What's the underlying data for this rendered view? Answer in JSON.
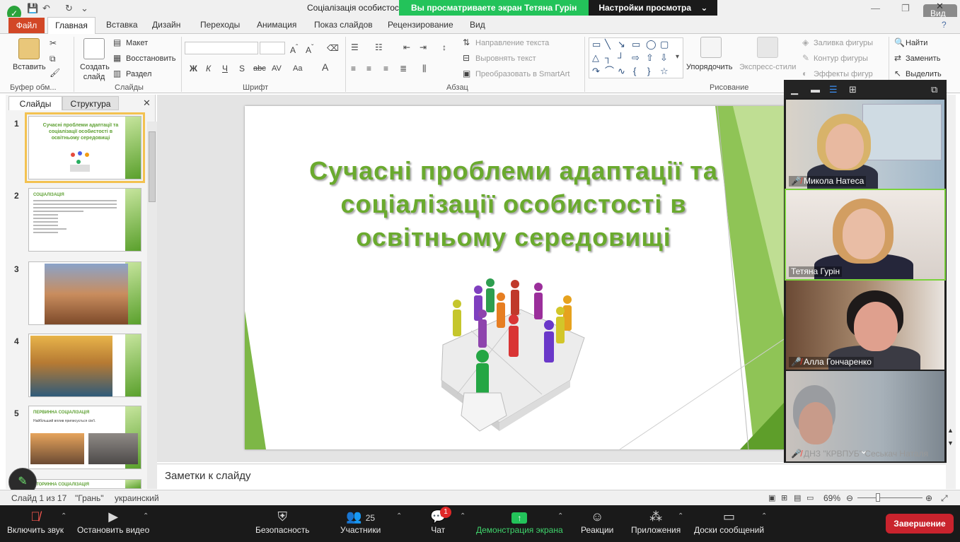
{
  "window": {
    "doc_title": "Соціалізація особистост",
    "view_button": "Вид"
  },
  "share_banner": {
    "viewing": "Вы просматриваете экран Тетяна Гурін",
    "settings": "Настройки просмотра"
  },
  "ribbon_tabs": [
    "Файл",
    "Главная",
    "Вставка",
    "Дизайн",
    "Переходы",
    "Анимация",
    "Показ слайдов",
    "Рецензирование",
    "Вид"
  ],
  "ribbon": {
    "clipboard": {
      "paste": "Вставить",
      "label": "Буфер обм..."
    },
    "slides": {
      "new_slide": "Создать слайд",
      "layout": "Макет",
      "reset": "Восстановить",
      "section": "Раздел",
      "label": "Слайды"
    },
    "font": {
      "label": "Шрифт",
      "bold": "Ж",
      "italic": "К",
      "underline": "Ч",
      "strike": "abc",
      "shadow": "S",
      "spacing": "AV",
      "case": "Aa"
    },
    "paragraph": {
      "text_direction": "Направление текста",
      "align_text": "Выровнять текст",
      "smartart": "Преобразовать в SmartArt",
      "label": "Абзац"
    },
    "drawing": {
      "arrange": "Упорядочить",
      "quick_styles": "Экспресс-стили",
      "fill": "Заливка фигуры",
      "outline": "Контур фигуры",
      "effects": "Эффекты фигур",
      "label": "Рисование"
    },
    "editing": {
      "find": "Найти",
      "replace": "Заменить",
      "select": "Выделить"
    }
  },
  "left_panel": {
    "tab_slides": "Слайды",
    "tab_outline": "Структура",
    "thumbnails": [
      {
        "num": "1",
        "title": "Сучасні проблеми адаптації та соціалізації особистості в освітньому середовищі"
      },
      {
        "num": "2",
        "title": "СОЦІАЛІЗАЦІЯ"
      },
      {
        "num": "3",
        "title": ""
      },
      {
        "num": "4",
        "title": ""
      },
      {
        "num": "5",
        "title": "ПЕРВИННА СОЦІАЛІЗАЦІЯ",
        "subtitle": "Найбільший вплив приписується сім'ї."
      },
      {
        "num": "6",
        "title": "ВТОРИННА СОЦІАЛІЗАЦІЯ"
      }
    ]
  },
  "slide": {
    "title": "Сучасні проблеми адаптації та соціалізації особистості в освітньому середовищі"
  },
  "notes": {
    "placeholder": "Заметки к слайду"
  },
  "status": {
    "slide_of": "Слайд 1 из 17",
    "theme": "\"Грань\"",
    "language": "украинский",
    "zoom": "69%"
  },
  "participants": [
    {
      "name": "Микола Натеса",
      "muted": true
    },
    {
      "name": "Тетяна Гурін",
      "muted": false
    },
    {
      "name": "Алла Гончаренко",
      "muted": true
    },
    {
      "name": "ДНЗ \"КРВПУБ\" Сеськач Наталя",
      "muted": true
    }
  ],
  "zoom_toolbar": {
    "unmute": "Включить звук",
    "stop_video": "Остановить видео",
    "security": "Безопасность",
    "participants": "Участники",
    "participants_count": "25",
    "chat": "Чат",
    "chat_badge": "1",
    "share_screen": "Демонстрация экрана",
    "reactions": "Реакции",
    "apps": "Приложения",
    "whiteboards": "Доски сообщений",
    "end": "Завершение"
  },
  "colors": {
    "slide_title_green": "#6aaa2e",
    "file_tab": "#d24726",
    "share_banner_green": "#23c35a",
    "end_button": "#c9232d"
  }
}
